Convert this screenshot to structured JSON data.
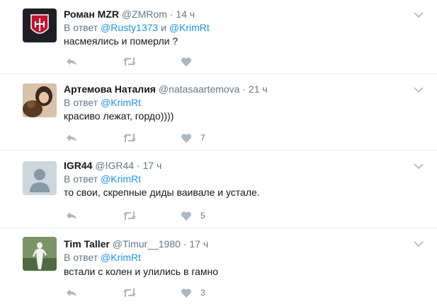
{
  "tweets": [
    {
      "name": "Роман MZR",
      "handle": "@ZMRom",
      "time": "14 ч",
      "reply_prefix": "В ответ",
      "mentions": [
        "@Rusty1373",
        "@KrimRt"
      ],
      "mention_join": "и",
      "text": "насмеялись и померли ?",
      "likes": "",
      "avatar": "red-emblem-avatar"
    },
    {
      "name": "Артемова Наталия",
      "handle": "@natasaartemova",
      "time": "21 ч",
      "reply_prefix": "В ответ",
      "mentions": [
        "@KrimRt"
      ],
      "text": "красиво лежат, гордо))))",
      "likes": "7",
      "avatar": "photo-avatar"
    },
    {
      "name": "IGR44",
      "handle": "@IGR44",
      "time": "17 ч",
      "reply_prefix": "В ответ",
      "mentions": [
        "@KrimRt"
      ],
      "text": "то свои, скрепные диды ваивале и устале.",
      "likes": "5",
      "avatar": "default-egg-avatar"
    },
    {
      "name": "Tim Taller",
      "handle": "@Timur__1980",
      "time": "17 ч",
      "reply_prefix": "В ответ",
      "mentions": [
        "@KrimRt"
      ],
      "text": "встали с колен и улились в гамно",
      "likes": "3",
      "avatar": "statue-photo-avatar"
    }
  ],
  "separator": "·",
  "colors": {
    "name": "#14171a",
    "meta": "#657786",
    "mention": "#1b95e0",
    "icon": "#aab8c2",
    "divider": "#e6ecf0"
  }
}
